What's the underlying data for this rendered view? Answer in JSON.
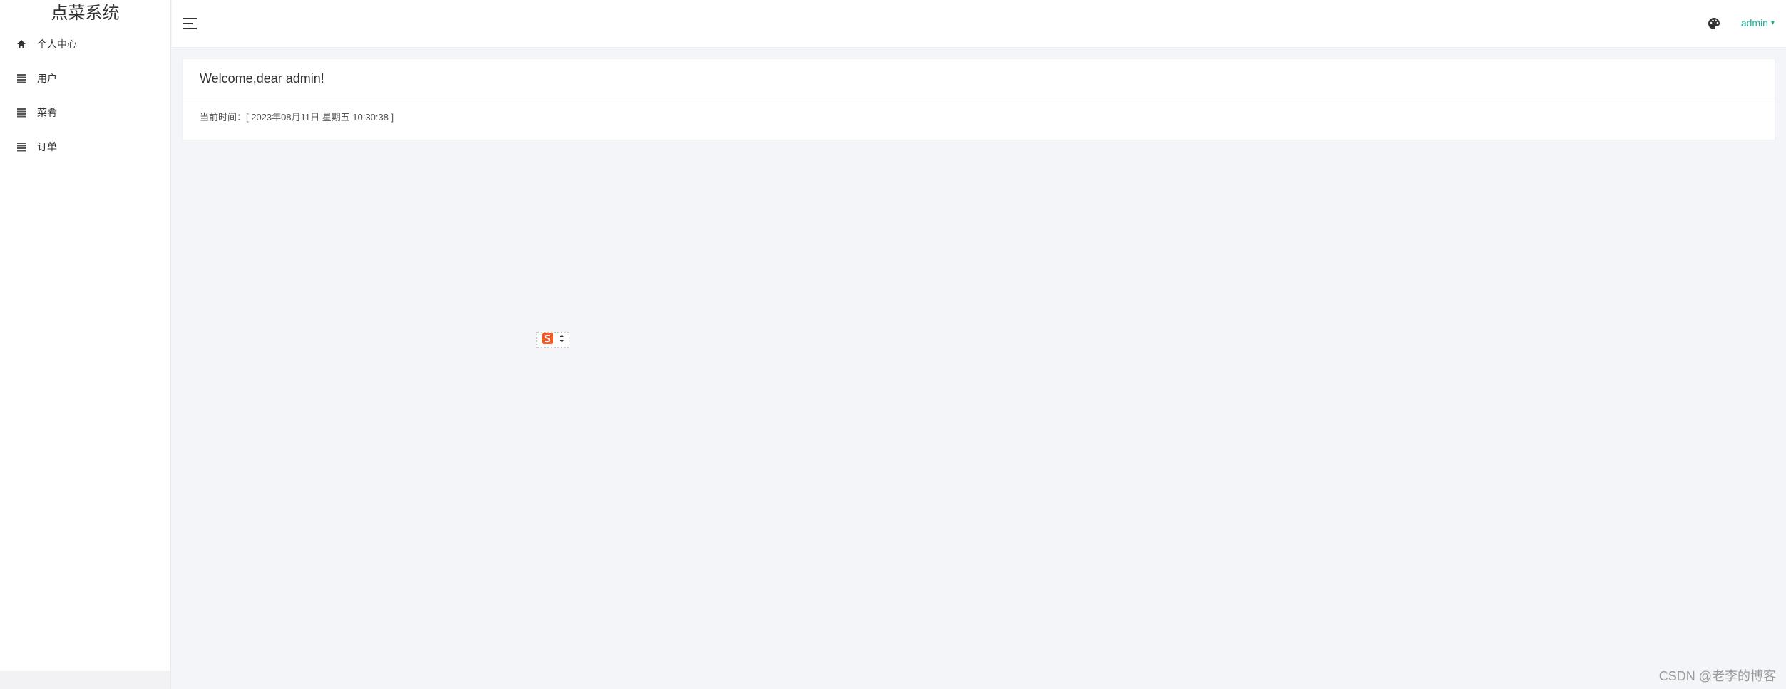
{
  "sidebar": {
    "title": "点菜系统",
    "items": [
      {
        "label": "个人中心",
        "icon": "home-icon"
      },
      {
        "label": "用户",
        "icon": "list-icon"
      },
      {
        "label": "菜肴",
        "icon": "list-icon"
      },
      {
        "label": "订单",
        "icon": "list-icon"
      }
    ]
  },
  "header": {
    "menu_toggle_icon": "hamburger-icon",
    "theme_icon": "palette-icon",
    "user_label": "admin",
    "accent_color": "#1ab394"
  },
  "welcome_card": {
    "title": "Welcome,dear admin!",
    "time_text": "当前时间：[ 2023年08月11日 星期五 10:30:38 ]"
  },
  "floating_widget": {
    "icon": "sogou-s-icon",
    "toggle_icon": "arrow-updown-icon"
  },
  "watermark": "CSDN @老李的博客"
}
